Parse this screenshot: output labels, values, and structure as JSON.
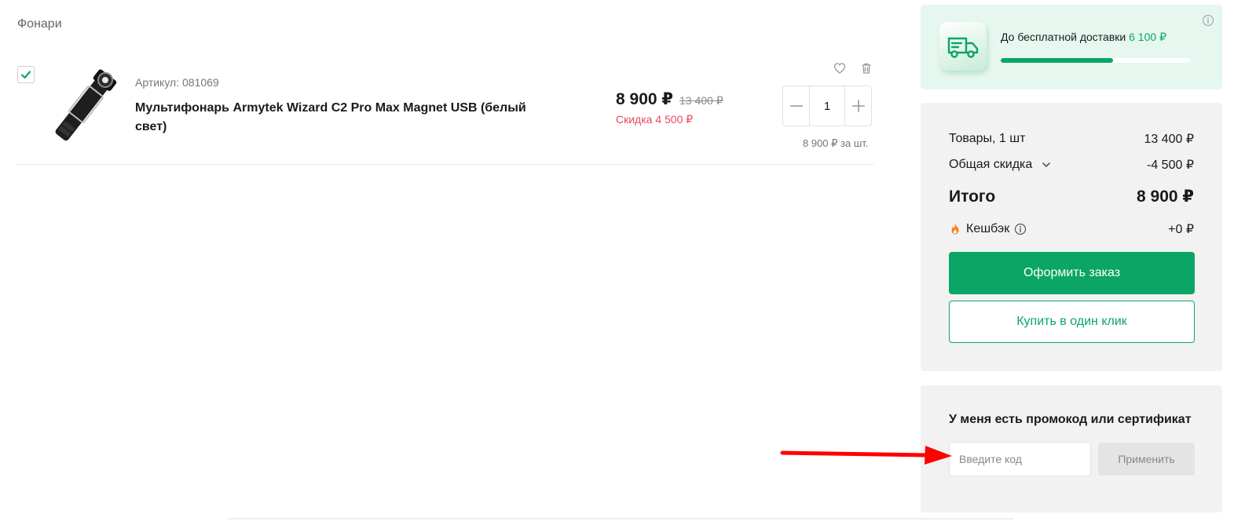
{
  "category": {
    "title": "Фонари"
  },
  "cart_item": {
    "sku_label": "Артикул: 081069",
    "name": "Мультифонарь Armytek Wizard C2 Pro Max Magnet USB (белый свет)",
    "price_current": "8 900 ₽",
    "price_old": "13 400 ₽",
    "discount_text": "Скидка 4 500 ₽",
    "quantity": "1",
    "unit_price": "8 900 ₽ за шт.",
    "checked": true,
    "icons": {
      "favorite": "heart-icon",
      "delete": "trash-icon",
      "minus": "minus-icon",
      "plus": "plus-icon"
    }
  },
  "delivery": {
    "label": "До бесплатной доставки",
    "amount": "6 100 ₽",
    "progress": 0.59,
    "icon": "truck-icon"
  },
  "summary": {
    "goods_label": "Товары, 1 шт",
    "goods_value": "13 400 ₽",
    "discount_label": "Общая скидка",
    "discount_value": "-4 500 ₽",
    "total_label": "Итого",
    "total_value": "8 900 ₽",
    "cashback_label": "Кешбэк",
    "cashback_value": "+0 ₽",
    "checkout_label": "Оформить заказ",
    "one_click_label": "Купить в один клик"
  },
  "promo": {
    "title": "У меня есть промокод или сертификат",
    "placeholder": "Введите код",
    "value": "",
    "apply_label": "Применить"
  },
  "colors": {
    "accent": "#0ba565",
    "discount": "#e8495b",
    "annotation_arrow": "#ff0000"
  }
}
